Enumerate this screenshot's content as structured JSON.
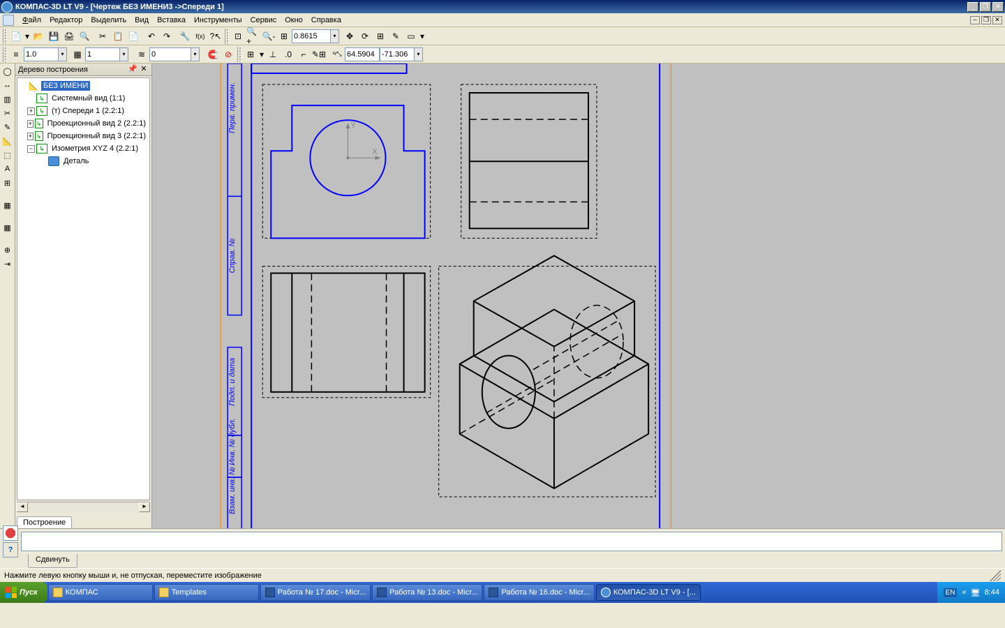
{
  "titlebar": {
    "text": "КОМПАС-3D LT V9 - [Чертеж БЕЗ ИМЕНИ3 ->Спереди 1]"
  },
  "menu": {
    "file": "Файл",
    "edit": "Редактор",
    "select": "Выделить",
    "view": "Вид",
    "insert": "Вставка",
    "tools": "Инструменты",
    "service": "Сервис",
    "window": "Окно",
    "help": "Справка"
  },
  "toolbar": {
    "zoom": "0.8615",
    "line_style": "1.0",
    "layer": "1",
    "color_val": "0",
    "coord_x": "64.5904",
    "coord_y": "-71.306"
  },
  "tree": {
    "title": "Дерево построения",
    "root": "БЕЗ ИМЕНИ",
    "items": [
      "Системный вид (1:1)",
      "(т) Спереди 1 (2.2:1)",
      "Проекционный вид 2 (2.2:1)",
      "Проекционный вид 3 (2.2:1)",
      "Изометрия XYZ 4 (2.2:1)"
    ],
    "child": "Деталь",
    "tab": "Построение"
  },
  "param": {
    "tab": "Сдвинуть"
  },
  "status": {
    "text": "Нажмите левую кнопку мыши и, не отпуская, переместите изображение"
  },
  "taskbar": {
    "start": "Пуск",
    "tasks": [
      "КОМПАС",
      "Templates",
      "Работа № 17.doc - Micr...",
      "Работа № 13.doc - Micr...",
      "Работа № 16.doc - Micr...",
      "КОМПАС-3D LT V9 - [..."
    ],
    "lang": "EN",
    "time": "8:44",
    "expand": "«"
  }
}
